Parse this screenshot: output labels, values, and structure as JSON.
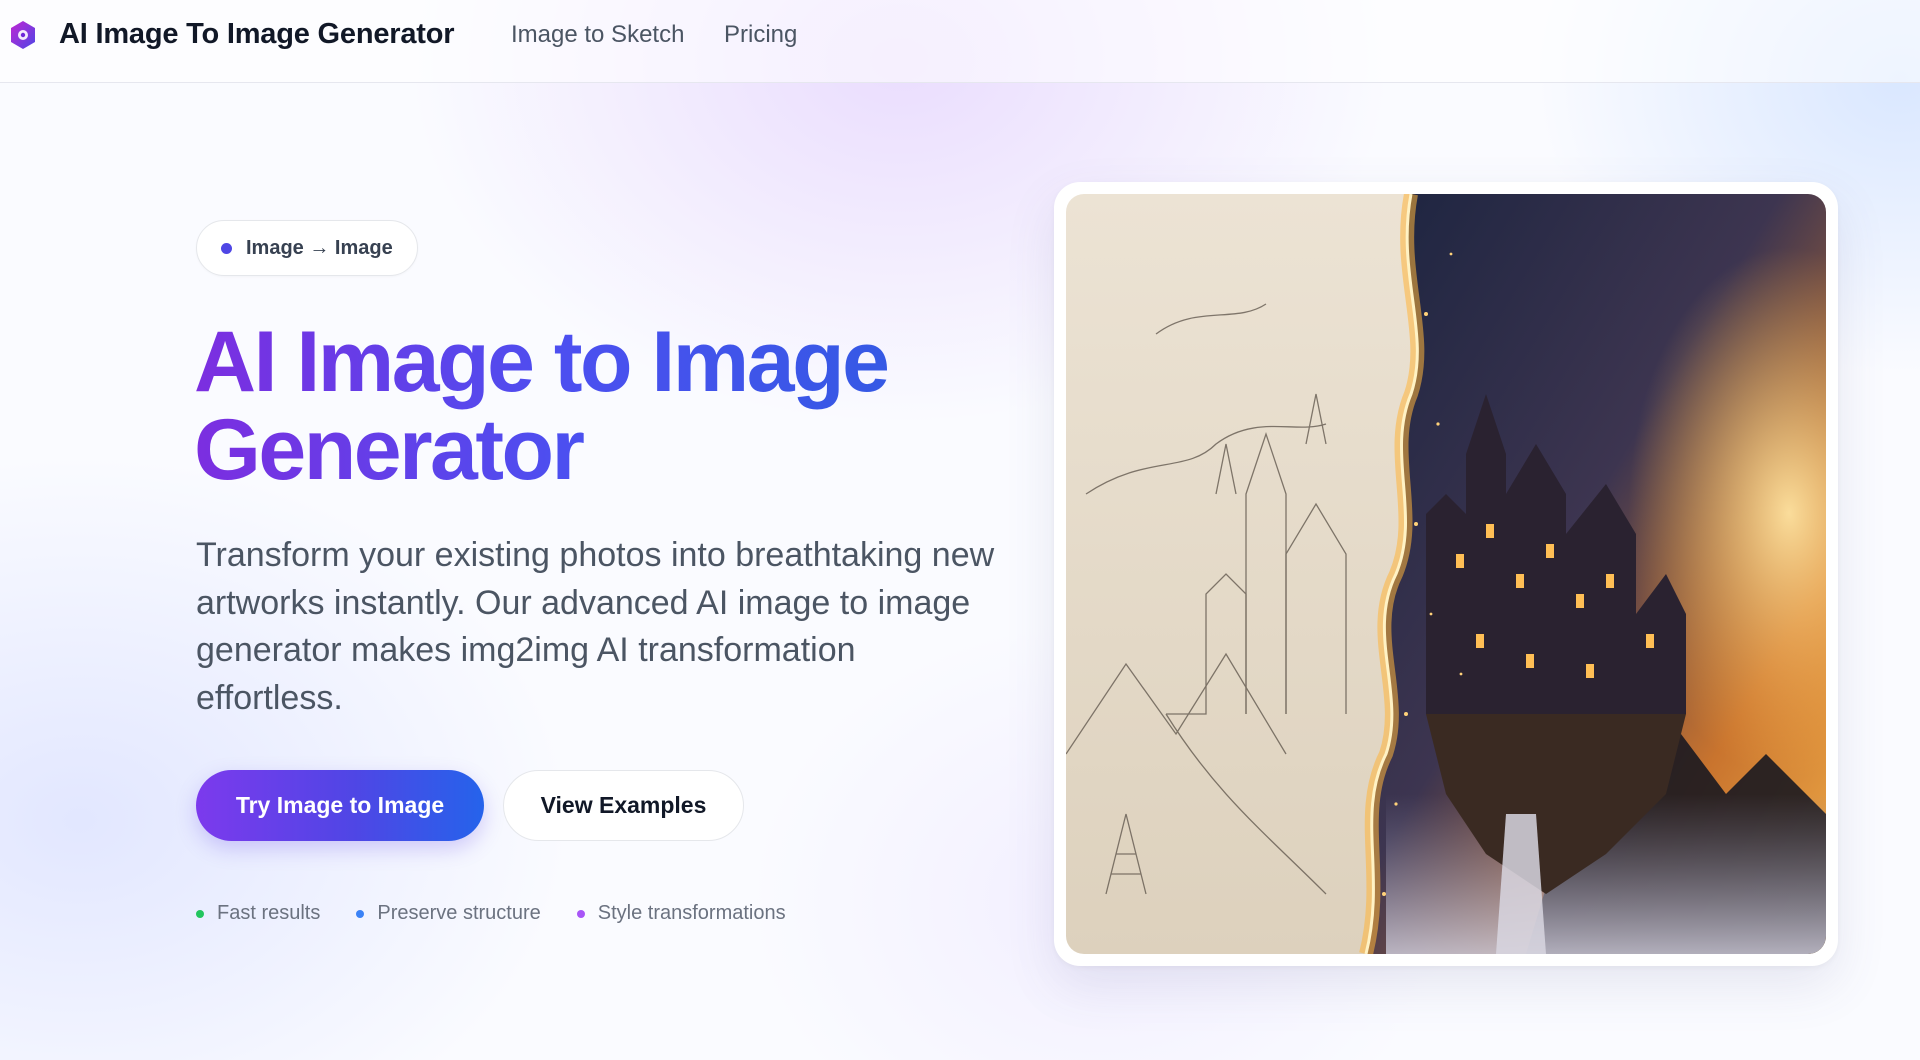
{
  "header": {
    "brand": "AI Image To Image Generator",
    "nav": [
      "Image to Sketch",
      "Pricing"
    ]
  },
  "hero": {
    "badge": "Image → Image",
    "title_line1": "AI Image to Image",
    "title_line2": "Generator",
    "description": "Transform your existing photos into breathtaking new artworks instantly. Our advanced AI image to image generator makes img2img AI transformation effortless.",
    "primary_cta": "Try Image to Image",
    "secondary_cta": "View Examples",
    "features": [
      {
        "label": "Fast results",
        "color": "#22c55e"
      },
      {
        "label": "Preserve structure",
        "color": "#3b82f6"
      },
      {
        "label": "Style transformations",
        "color": "#a855f7"
      }
    ]
  },
  "colors": {
    "brand_purple": "#7c3aed",
    "brand_blue": "#2563eb"
  }
}
